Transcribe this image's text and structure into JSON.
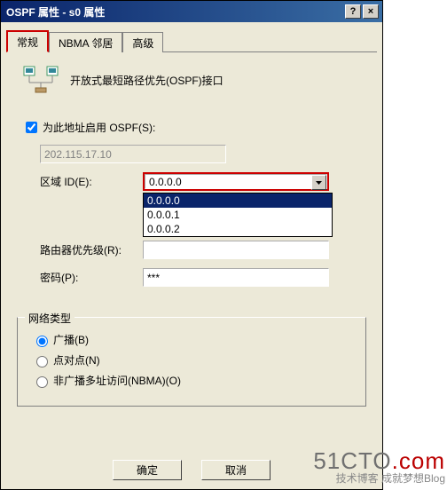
{
  "titlebar": {
    "title": "OSPF 属性 - s0 属性"
  },
  "tabs": {
    "general": "常规",
    "nbma": "NBMA 邻居",
    "advanced": "高级"
  },
  "header": {
    "desc": "开放式最短路径优先(OSPF)接口"
  },
  "form": {
    "enable_label": "为此地址启用 OSPF(S):",
    "address": "202.115.17.10",
    "area_label": "区域 ID(E):",
    "area_value": "0.0.0.0",
    "area_options": [
      "0.0.0.0",
      "0.0.0.1",
      "0.0.0.2"
    ],
    "priority_label": "路由器优先级(R):",
    "priority_value": "",
    "password_label": "密码(P):",
    "password_value": "***"
  },
  "fieldset": {
    "legend": "网络类型",
    "broadcast": "广播(B)",
    "ptp": "点对点(N)",
    "nbma": "非广播多址访问(NBMA)(O)"
  },
  "buttons": {
    "ok": "确定",
    "cancel": "取消"
  },
  "watermark": {
    "line1_a": "51CTO",
    "line1_b": ".com",
    "line2": "技术博客 成就梦想Blog"
  }
}
